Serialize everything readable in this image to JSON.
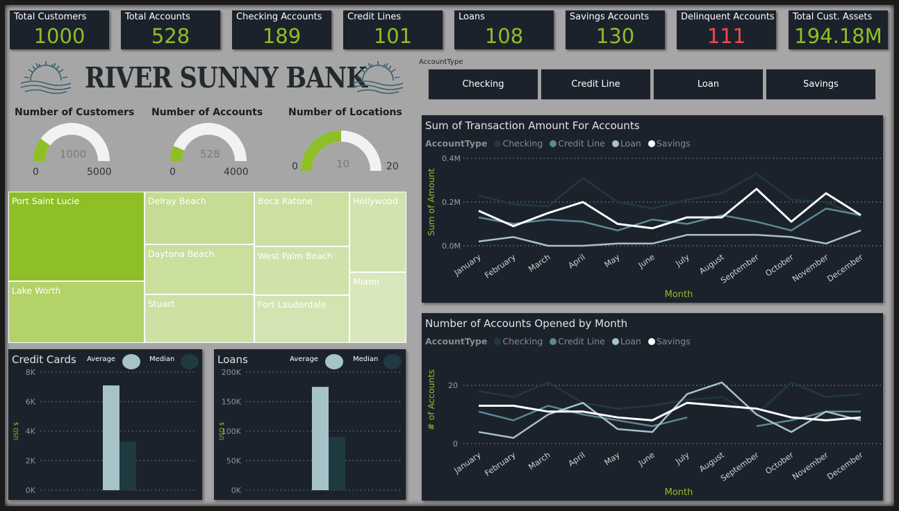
{
  "kpis": [
    {
      "label": "Total Customers",
      "value": "1000",
      "color": "#8fbf26"
    },
    {
      "label": "Total Accounts",
      "value": "528",
      "color": "#8fbf26"
    },
    {
      "label": "Checking Accounts",
      "value": "189",
      "color": "#8fbf26"
    },
    {
      "label": "Credit Lines",
      "value": "101",
      "color": "#8fbf26"
    },
    {
      "label": "Loans",
      "value": "108",
      "color": "#8fbf26"
    },
    {
      "label": "Savings Accounts",
      "value": "130",
      "color": "#8fbf26"
    },
    {
      "label": "Delinquent Accounts",
      "value": "111",
      "color": "#f04a4f"
    },
    {
      "label": "Total Cust. Assets",
      "value": "194.18M",
      "color": "#8fbf26"
    }
  ],
  "brand": {
    "name": "RIVER SUNNY BANK",
    "icon": "sunrise-waves-icon"
  },
  "gauges": [
    {
      "title": "Number of Customers",
      "value": 1000,
      "min": 0,
      "max": 5000,
      "value_label": "1000",
      "min_label": "0",
      "max_label": "5000"
    },
    {
      "title": "Number of Accounts",
      "value": 528,
      "min": 0,
      "max": 4000,
      "value_label": "528",
      "min_label": "0",
      "max_label": "4000"
    },
    {
      "title": "Number of Locations",
      "value": 10,
      "min": 0,
      "max": 20,
      "value_label": "10",
      "min_label": "0",
      "max_label": "20"
    }
  ],
  "slicer": {
    "title": "AccountType",
    "options": [
      "Checking",
      "Credit Line",
      "Loan",
      "Savings"
    ]
  },
  "treemap": {
    "locations": [
      "Port Saint Lucie",
      "Lake Worth",
      "Delray Beach",
      "Daytona Beach",
      "Stuart",
      "Boca Ratone",
      "West Palm Beach",
      "Fort Lauderdale",
      "Hollywood",
      "Miami"
    ]
  },
  "colors": {
    "accent": "#8fbf26",
    "panel": "#1c222c",
    "checking": "#1f3a40",
    "credit_line": "#5b8a93",
    "loan": "#a7c3ca",
    "savings": "#ffffff",
    "delinquent": "#f04a4f"
  },
  "credit_cards": {
    "title": "Credit Cards",
    "legend": [
      "Average",
      "Median"
    ],
    "ylabel": "USD $",
    "ticks": [
      "8K",
      "6K",
      "4K",
      "2K",
      "0K"
    ]
  },
  "loans_panel": {
    "title": "Loans",
    "legend": [
      "Average",
      "Median"
    ],
    "ylabel": "USD $",
    "ticks": [
      "200K",
      "150K",
      "100K",
      "50K",
      "0K"
    ]
  },
  "chart_data": [
    {
      "type": "line",
      "title": "Sum of Transaction Amount For Accounts",
      "legend_title": "AccountType",
      "xlabel": "Month",
      "ylabel": "Sum of Amount",
      "y_ticks": [
        "0.4M",
        "0.2M",
        "0.0M"
      ],
      "ylim": [
        0,
        400000
      ],
      "categories": [
        "January",
        "February",
        "March",
        "April",
        "May",
        "June",
        "July",
        "August",
        "September",
        "October",
        "November",
        "December"
      ],
      "series": [
        {
          "name": "Checking",
          "values": [
            230000,
            190000,
            180000,
            310000,
            200000,
            170000,
            210000,
            240000,
            330000,
            210000,
            200000,
            130000
          ]
        },
        {
          "name": "Credit Line",
          "values": [
            130000,
            100000,
            120000,
            110000,
            70000,
            120000,
            100000,
            140000,
            110000,
            70000,
            170000,
            140000
          ]
        },
        {
          "name": "Loan",
          "values": [
            20000,
            40000,
            0,
            0,
            10000,
            10000,
            50000,
            50000,
            50000,
            40000,
            10000,
            70000
          ]
        },
        {
          "name": "Savings",
          "values": [
            160000,
            90000,
            150000,
            200000,
            100000,
            80000,
            130000,
            130000,
            260000,
            110000,
            240000,
            140000
          ]
        }
      ]
    },
    {
      "type": "line",
      "title": "Number of Accounts Opened by Month",
      "legend_title": "AccountType",
      "xlabel": "Month",
      "ylabel": "# of Accounts",
      "y_ticks": [
        "20",
        "0"
      ],
      "ylim": [
        0,
        25
      ],
      "categories": [
        "January",
        "February",
        "March",
        "April",
        "May",
        "June",
        "July",
        "August",
        "September",
        "October",
        "November",
        "December"
      ],
      "series": [
        {
          "name": "Checking",
          "values": [
            18,
            16,
            21,
            14,
            12,
            13,
            15,
            16,
            10,
            21,
            16,
            17
          ]
        },
        {
          "name": "Credit Line",
          "values": [
            11,
            8,
            13,
            10,
            8,
            6,
            9,
            null,
            6,
            8,
            11,
            11
          ]
        },
        {
          "name": "Loan",
          "values": [
            4,
            2,
            10,
            14,
            5,
            4,
            17,
            21,
            10,
            4,
            11,
            8
          ]
        },
        {
          "name": "Savings",
          "values": [
            13,
            13,
            11,
            11,
            9,
            8,
            14,
            13,
            12,
            9,
            8,
            9
          ]
        }
      ]
    },
    {
      "type": "bar",
      "title": "Credit Cards",
      "categories": [
        "Average",
        "Median"
      ],
      "values": [
        7100,
        3300
      ],
      "ylim": [
        0,
        8000
      ]
    },
    {
      "type": "bar",
      "title": "Loans",
      "categories": [
        "Average",
        "Median"
      ],
      "values": [
        175000,
        90000
      ],
      "ylim": [
        0,
        200000
      ]
    }
  ]
}
